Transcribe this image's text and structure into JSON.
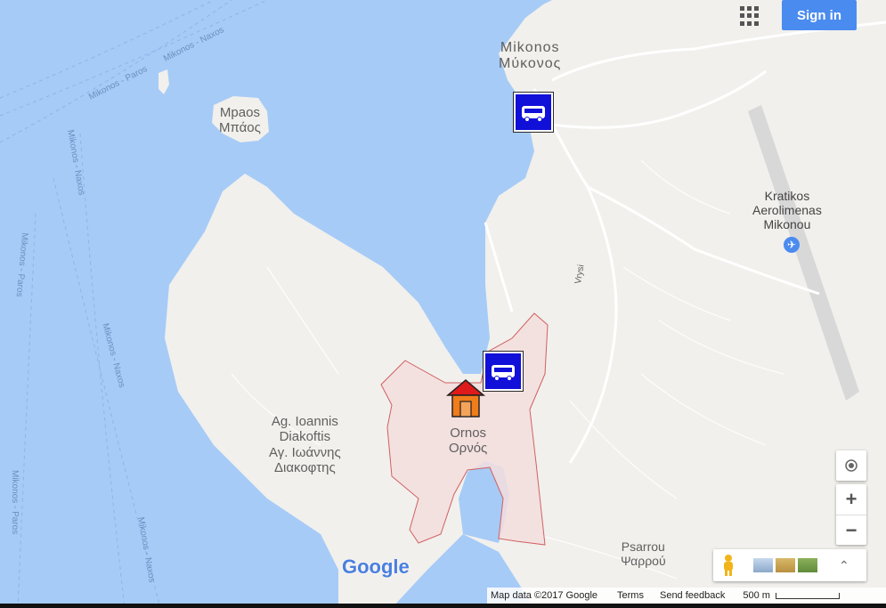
{
  "header": {
    "signin_label": "Sign in"
  },
  "places": {
    "mykonos_latin": "Mikonos",
    "mykonos_greek": "Μύκονος",
    "mpraos_latin": "Mpaos",
    "mpraos_greek": "Μπάος",
    "airport_line1": "Kratikos",
    "airport_line2": "Aerolimenas",
    "airport_line3": "Mikonou",
    "vrysi": "Vrysi",
    "ag_ioannis_1": "Ag. Ioannis",
    "ag_ioannis_2": "Diakoftis",
    "ag_ioannis_3": "Αγ. Ιωάννης",
    "ag_ioannis_4": "Διακοφτης",
    "ornos_latin": "Ornos",
    "ornos_greek": "Ορνός",
    "psarrou_latin": "Psarrou",
    "psarrou_greek": "Ψαρρού"
  },
  "ferry_routes": {
    "r1": "Mikonos - Paros",
    "r2": "Mikonos - Naxos",
    "r3": "Mikonos - Naxos",
    "r4": "Mikonos - Paros",
    "r5": "Mikonos - Naxos",
    "r6": "Mikonos - Paros",
    "r7": "Mikonos - Naxos",
    "r8": "Mikonos - Paros"
  },
  "footer": {
    "map_data": "Map data ©2017 Google",
    "terms": "Terms",
    "feedback": "Send feedback",
    "scale": "500 m"
  },
  "logo": "Google",
  "colors": {
    "water": "#a6cbf7",
    "land": "#f1f0ec",
    "ornos_fill": "#f3dede",
    "ornos_stroke": "#d06060",
    "bus": "#1010d8",
    "house": "#f07c1a",
    "roof": "#e01a1a"
  }
}
